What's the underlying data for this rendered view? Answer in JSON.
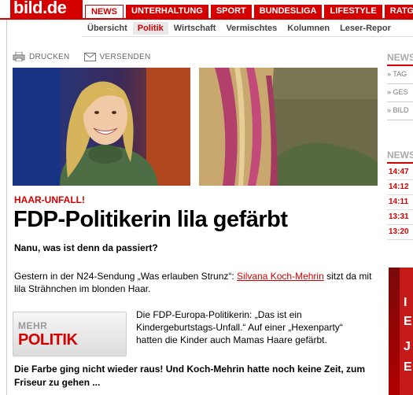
{
  "logo": {
    "text": "bild.de"
  },
  "topnav": {
    "tabs": [
      {
        "label": "NEWS",
        "active": true
      },
      {
        "label": "UNTERHALTUNG",
        "active": false
      },
      {
        "label": "SPORT",
        "active": false
      },
      {
        "label": "BUNDESLIGA",
        "active": false
      },
      {
        "label": "LIFESTYLE",
        "active": false
      },
      {
        "label": "RATGE",
        "active": false
      }
    ]
  },
  "subnav": {
    "items": [
      {
        "label": "Übersicht",
        "active": false
      },
      {
        "label": "Politik",
        "active": true
      },
      {
        "label": "Wirtschaft",
        "active": false
      },
      {
        "label": "Vermischtes",
        "active": false
      },
      {
        "label": "Kolumnen",
        "active": false
      },
      {
        "label": "Leser-Repor",
        "active": false
      }
    ]
  },
  "tools": {
    "print_label": "DRUCKEN",
    "send_label": "VERSENDEN"
  },
  "article": {
    "kicker": "HAAR-UNFALL!",
    "headline": "FDP-Politikerin lila gefärbt",
    "intro": "Nanu, was ist denn da passiert?",
    "p1_before": "Gestern in der N24-Sendung „Was erlauben Strunz“: ",
    "p1_link": "Silvana Koch-Mehrin",
    "p1_after": " sitzt da mit lila Strähnchen im blonden Haar.",
    "p2": "Die FDP-Europa-Politikerin: „Das ist ein Kindergeburtstags-Unfall.“ Auf einer „Hexenparty“ hatten die Kinder auch Mamas Haare gefärbt.",
    "p3": "Die Farbe ging nicht wieder raus! Und Koch-Mehrin hatte noch keine Zeit, zum Friseur zu gehen ..."
  },
  "mehr": {
    "line1": "MEHR",
    "line2": "POLITIK"
  },
  "right": {
    "head1": "NEWS",
    "links": [
      "» TAG",
      "» GES",
      "» BILD"
    ],
    "head2": "NEWS",
    "times": [
      "14:47",
      "14:12",
      "14:11",
      "13:31",
      "13:20"
    ],
    "ad_glyphs": [
      "I",
      "E",
      "J",
      "E"
    ]
  },
  "colors": {
    "brand_red": "#d40000"
  }
}
